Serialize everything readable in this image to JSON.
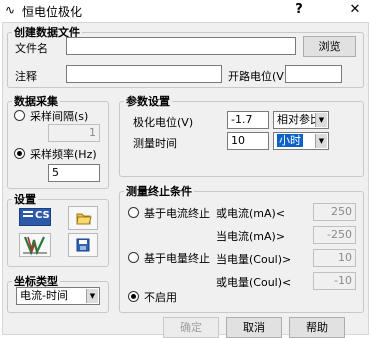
{
  "window": {
    "title": "恒电位极化",
    "help_symbol": "?",
    "close_symbol": "✕"
  },
  "create_file": {
    "legend": "创建数据文件",
    "filename_label": "文件名",
    "filename_value": "",
    "browse_label": "浏览",
    "note_label": "注释",
    "note_value": "",
    "ocp_label": "开路电位(V)",
    "ocp_value": ""
  },
  "data_acq": {
    "legend": "数据采集",
    "interval_label": "采样间隔(s)",
    "interval_value": "1",
    "freq_label": "采样频率(Hz)",
    "freq_value": "5",
    "selected": "freq"
  },
  "params": {
    "legend": "参数设置",
    "potential_label": "极化电位(V)",
    "potential_value": "-1.7",
    "potential_ref": "相对参比",
    "time_label": "测量时间",
    "time_value": "10",
    "time_unit": "小时"
  },
  "settings": {
    "legend": "设置",
    "icons": [
      "cs-icon",
      "open-folder-icon",
      "chart-icon",
      "save-icon"
    ],
    "cs_text": "CS"
  },
  "coord": {
    "legend": "坐标类型",
    "value": "电流-时间"
  },
  "termination": {
    "legend": "测量终止条件",
    "opt_current": "基于电流终止",
    "opt_charge": "基于电量终止",
    "opt_none": "不启用",
    "selected": "none",
    "i_or_label": "或电流(mA)<",
    "i_or_value": "250",
    "i_when_label": "当电流(mA)>",
    "i_when_value": "-250",
    "q_when_label": "当电量(Coul)>",
    "q_when_value": "10",
    "q_or_label": "或电量(Coul)<",
    "q_or_value": "-10"
  },
  "footer": {
    "ok_label": "确定",
    "cancel_label": "取消",
    "help_label": "帮助"
  }
}
